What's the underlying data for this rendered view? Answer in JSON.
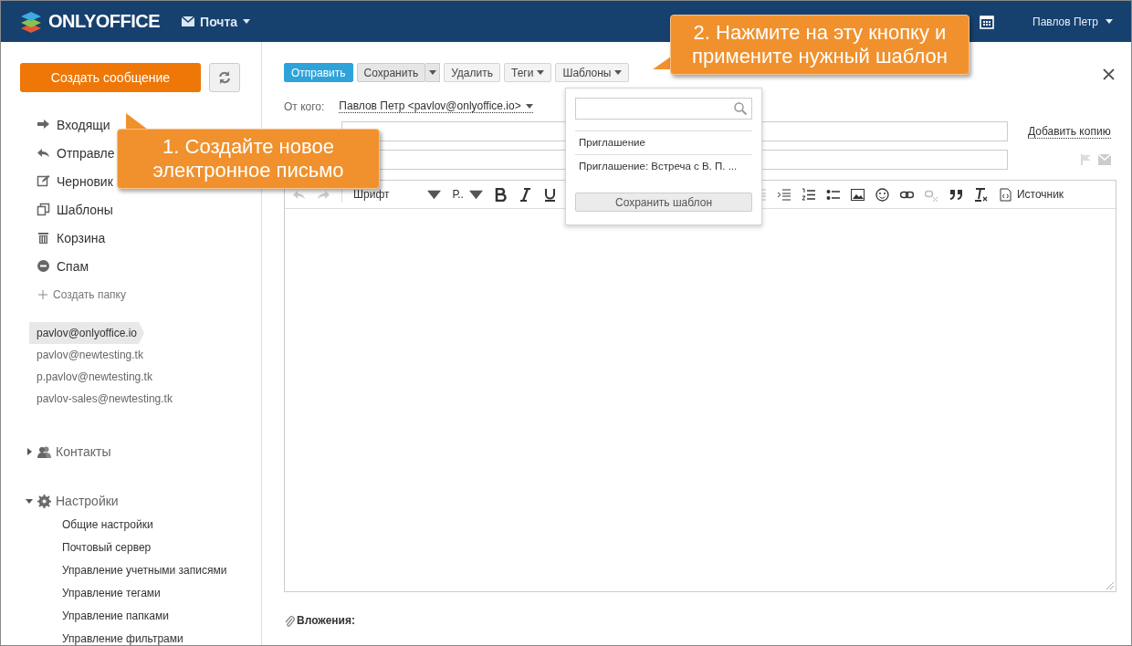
{
  "header": {
    "logo": "ONLYOFFICE",
    "module": "Почта",
    "user": "Павлов Петр"
  },
  "sidebar": {
    "create_button": "Создать сообщение",
    "folders": [
      {
        "label": "Входящи",
        "kind": "inbox"
      },
      {
        "label": "Отправле",
        "kind": "sent"
      },
      {
        "label": "Черновик",
        "kind": "drafts"
      },
      {
        "label": "Шаблоны",
        "kind": "templates"
      },
      {
        "label": "Корзина",
        "kind": "trash"
      },
      {
        "label": "Спам",
        "kind": "spam"
      }
    ],
    "create_folder": "Создать папку",
    "accounts": [
      {
        "address": "pavlov@onlyoffice.io",
        "selected": true
      },
      {
        "address": "pavlov@newtesting.tk",
        "selected": false
      },
      {
        "address": "p.pavlov@newtesting.tk",
        "selected": false
      },
      {
        "address": "pavlov-sales@newtesting.tk",
        "selected": false
      }
    ],
    "contacts": {
      "label": "Контакты",
      "expanded": false
    },
    "settings": {
      "label": "Настройки",
      "expanded": true,
      "children": [
        "Общие настройки",
        "Почтовый сервер",
        "Управление учетными записями",
        "Управление тегами",
        "Управление папками",
        "Управление фильтрами"
      ]
    }
  },
  "compose": {
    "toolbar": [
      {
        "label": "Отправить",
        "kind": "primary"
      },
      {
        "label": "Сохранить",
        "kind": "split"
      },
      {
        "label": "Удалить",
        "kind": "plain"
      },
      {
        "label": "Теги",
        "kind": "menu"
      },
      {
        "label": "Шаблоны",
        "kind": "menu"
      }
    ],
    "from_label": "От кого:",
    "from_value": "Павлов Петр <pavlov@onlyoffice.io>",
    "add_copy": "Добавить копию",
    "editor": {
      "font": "Шрифт",
      "size": "Р..",
      "source": "Источник"
    },
    "attachments": "Вложения:"
  },
  "templates_menu": {
    "items": [
      "Приглашение",
      "Приглашение: Встреча с В. П. ..."
    ],
    "save_button": "Сохранить шаблон"
  },
  "callouts": [
    {
      "text": "1. Создайте новое электронное письмо"
    },
    {
      "text": "2. Нажмите на эту кнопку и примените нужный шаблон"
    }
  ]
}
